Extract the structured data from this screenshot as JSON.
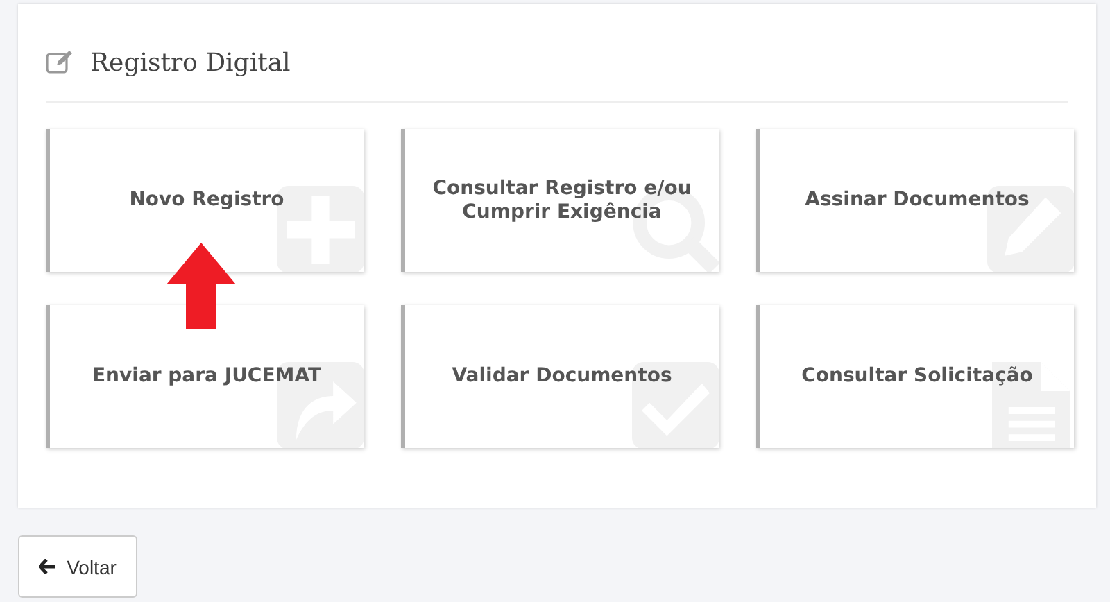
{
  "panel": {
    "title": "Registro Digital"
  },
  "cards": [
    {
      "label": "Novo Registro"
    },
    {
      "label": "Consultar Registro e/ou Cumprir Exigência"
    },
    {
      "label": "Assinar Documentos"
    },
    {
      "label": "Enviar para JUCEMAT"
    },
    {
      "label": "Validar Documentos"
    },
    {
      "label": "Consultar Solicitação"
    }
  ],
  "back_button": {
    "label": "Voltar"
  }
}
